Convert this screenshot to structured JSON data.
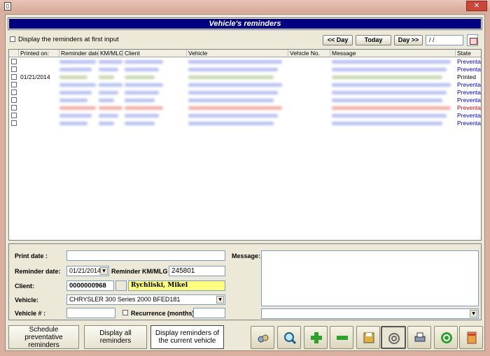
{
  "window": {
    "title": "Vehicle's reminders",
    "close_glyph": "✕",
    "app_icon": "document-icon"
  },
  "topbar": {
    "display_first_label": "Display the reminders at first input",
    "prev_day": "<< Day",
    "today": "Today",
    "next_day": "Day >>",
    "date_value": "/ /"
  },
  "grid": {
    "columns": [
      "Printed on:",
      "Reminder date",
      "KM/MLG",
      "Client",
      "Vehicle",
      "Vehicle No.",
      "Message",
      "State"
    ],
    "rows": [
      {
        "printed_on": "",
        "state": "Preventativ",
        "status": "preventative"
      },
      {
        "printed_on": "",
        "state": "Preventativ",
        "status": "preventative"
      },
      {
        "printed_on": "01/21/2014",
        "state": "Printed",
        "status": "printed"
      },
      {
        "printed_on": "",
        "state": "Preventativ",
        "status": "preventative"
      },
      {
        "printed_on": "",
        "state": "Preventativ",
        "status": "preventative"
      },
      {
        "printed_on": "",
        "state": "Preventativ",
        "status": "preventative"
      },
      {
        "printed_on": "",
        "state": "Preventativ",
        "status": "late"
      },
      {
        "printed_on": "",
        "state": "Preventativ",
        "status": "preventative"
      },
      {
        "printed_on": "",
        "state": "Preventativ",
        "status": "preventative"
      }
    ]
  },
  "form": {
    "print_date_label": "Print date :",
    "print_date_value": "",
    "message_label": "Message:",
    "reminder_date_label": "Reminder date:",
    "reminder_date_value": "01/21/2014",
    "reminder_km_label": "Reminder KM/MLG :",
    "reminder_km_value": "245801",
    "client_label": "Client:",
    "client_code": "0000000968",
    "client_name": "Rychliski, Mikel",
    "vehicle_label": "Vehicle:",
    "vehicle_value": "CHRYSLER 300 Series 2000 BFED181",
    "vehicle_no_label": "Vehicle # :",
    "vehicle_no_value": "",
    "recurrence_label": "Recurrence (months) :",
    "recurrence_value": ""
  },
  "buttons": {
    "schedule": "Schedule preventative reminders",
    "display_all": "Display all reminders",
    "display_current": "Display reminders of the current vehicle"
  },
  "colors": {
    "title_band": "#000080",
    "client_highlight": "#ffff80",
    "state_preventative": "#0000cc",
    "state_late": "#cc0000"
  }
}
